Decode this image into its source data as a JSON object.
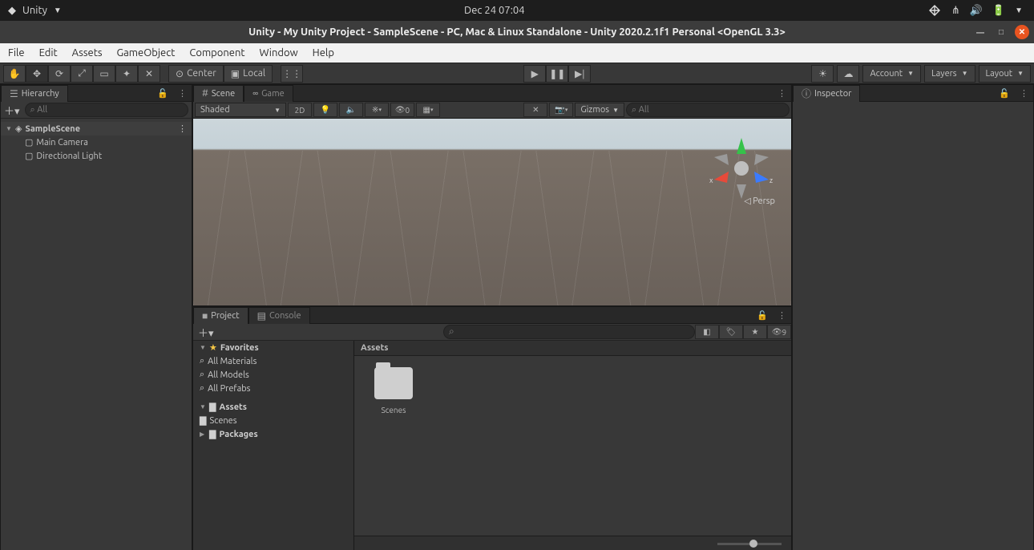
{
  "os": {
    "app_menu": "Unity",
    "clock": "Dec 24  07:04"
  },
  "window": {
    "title": "Unity - My Unity Project - SampleScene - PC, Mac & Linux Standalone - Unity 2020.2.1f1 Personal <OpenGL 3.3>"
  },
  "menubar": [
    "File",
    "Edit",
    "Assets",
    "GameObject",
    "Component",
    "Window",
    "Help"
  ],
  "toolbar": {
    "pivot": "Center",
    "space": "Local",
    "account": "Account",
    "layers": "Layers",
    "layout": "Layout"
  },
  "hierarchy": {
    "tab": "Hierarchy",
    "search_placeholder": "All",
    "scene": "SampleScene",
    "items": [
      "Main Camera",
      "Directional Light"
    ]
  },
  "scene": {
    "tab_scene": "Scene",
    "tab_game": "Game",
    "draw_mode": "Shaded",
    "btn_2d": "2D",
    "fx_count": "0",
    "gizmos": "Gizmos",
    "search_placeholder": "All",
    "persp": "Persp",
    "axis_x": "x",
    "axis_y": "",
    "axis_z": "z"
  },
  "project": {
    "tab_project": "Project",
    "tab_console": "Console",
    "hidden_count": "9",
    "favorites": "Favorites",
    "fav_items": [
      "All Materials",
      "All Models",
      "All Prefabs"
    ],
    "assets": "Assets",
    "assets_children": [
      "Scenes"
    ],
    "packages": "Packages",
    "breadcrumb": "Assets",
    "folder_name": "Scenes"
  },
  "inspector": {
    "tab": "Inspector"
  }
}
